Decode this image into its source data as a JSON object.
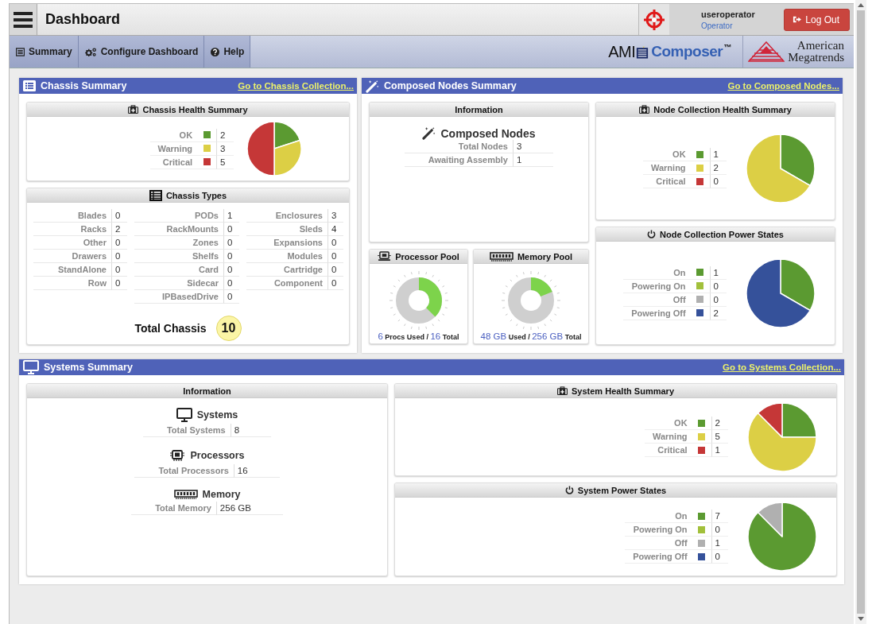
{
  "header": {
    "title": "Dashboard",
    "user": "useroperator",
    "role": "Operator",
    "logout": "Log Out"
  },
  "nav": {
    "tabs": [
      {
        "label": "Summary",
        "kind": "summary"
      },
      {
        "label": "Configure Dashboard",
        "kind": "configure"
      },
      {
        "label": "Help",
        "kind": "help"
      }
    ],
    "brand": {
      "product_prefix": "AMI",
      "product_name": "Composer",
      "trademark": "™",
      "company_line_1": "American",
      "company_line_2": "Megatrends"
    }
  },
  "chassis_summary": {
    "title": "Chassis Summary",
    "link": "Go to Chassis Collection...",
    "health": {
      "title": "Chassis Health Summary",
      "legend": [
        {
          "color": "#5b9a31",
          "value": "2"
        },
        {
          "color": "#dccf45",
          "value": "3"
        },
        {
          "color": "#c53737",
          "value": "5"
        }
      ],
      "chart_data": {
        "type": "pie",
        "categories": [
          "OK",
          "Warning",
          "Critical"
        ],
        "values": [
          20,
          30,
          50
        ]
      }
    },
    "types": {
      "title": "Chassis Types",
      "columns": [
        [
          {
            "label": "Blades",
            "value": "0"
          },
          {
            "label": "Racks",
            "value": "2"
          },
          {
            "label": "Other",
            "value": "0"
          },
          {
            "label": "Drawers",
            "value": "0"
          },
          {
            "label": "StandAlone",
            "value": "0"
          },
          {
            "label": "Row",
            "value": "0"
          }
        ],
        [
          {
            "label": "PODs",
            "value": "1"
          },
          {
            "label": "RackMounts",
            "value": "0"
          },
          {
            "label": "Zones",
            "value": "0"
          },
          {
            "label": "Shelfs",
            "value": "0"
          },
          {
            "label": "Card",
            "value": "0"
          },
          {
            "label": "Sidecar",
            "value": "0"
          },
          {
            "label": "IPBasedDrive",
            "value": "0"
          }
        ],
        [
          {
            "label": "Enclosures",
            "value": "3"
          },
          {
            "label": "Sleds",
            "value": "4"
          },
          {
            "label": "Expansions",
            "value": "0"
          },
          {
            "label": "Modules",
            "value": "0"
          },
          {
            "label": "Cartridge",
            "value": "0"
          },
          {
            "label": "Component",
            "value": "0"
          }
        ]
      ],
      "total": {
        "label": "Total Chassis",
        "value": "10"
      }
    }
  },
  "composed_nodes_summary": {
    "title": "Composed Nodes Summary",
    "link": "Go to Composed Nodes...",
    "information": {
      "title": "Information",
      "heading": "Composed Nodes",
      "rows": [
        {
          "label": "Total Nodes",
          "value": "3"
        },
        {
          "label": "Awaiting Assembly",
          "value": "1"
        }
      ]
    },
    "processor_pool": {
      "title": "Processor Pool",
      "kind": "processor",
      "used": "6",
      "used_label": "Procs Used /",
      "total": "16",
      "total_label": "Total"
    },
    "memory_pool": {
      "title": "Memory Pool",
      "kind": "memory",
      "used": "48 GB",
      "used_label": "Used /",
      "total": "256 GB",
      "total_label": "Total"
    },
    "health": {
      "title": "Node Collection Health Summary",
      "legend": [
        {
          "color": "#5b9a31",
          "value": "1"
        },
        {
          "color": "#dccf45",
          "value": "2"
        },
        {
          "color": "#c53737",
          "value": "0"
        }
      ],
      "chart_data": {
        "type": "pie",
        "categories": [
          "OK",
          "Warning",
          "Critical"
        ],
        "values": [
          33.33,
          66.67,
          0
        ]
      }
    },
    "power": {
      "title": "Node Collection Power States",
      "legend": [
        {
          "color": "#5b9a31",
          "value": "1"
        },
        {
          "color": "#a2c03b",
          "value": "0"
        },
        {
          "color": "#b0b0b0",
          "value": "0"
        },
        {
          "color": "#35519a",
          "value": "2"
        }
      ],
      "chart_data": {
        "type": "pie",
        "categories": [
          "On",
          "Powering On",
          "Off",
          "Powering Off"
        ],
        "values": [
          33.33,
          0,
          0,
          66.67
        ]
      }
    }
  },
  "systems_summary": {
    "title": "Systems Summary",
    "link": "Go to Systems Collection...",
    "information": {
      "title": "Information",
      "groups": [
        {
          "kind": "systems",
          "heading": "Systems",
          "label": "Total Systems",
          "value": "8"
        },
        {
          "kind": "processors",
          "heading": "Processors",
          "label": "Total Processors",
          "value": "16"
        },
        {
          "kind": "memory",
          "heading": "Memory",
          "label": "Total Memory",
          "value": "256 GB"
        }
      ]
    },
    "health": {
      "title": "System Health Summary",
      "legend": [
        {
          "color": "#5b9a31",
          "value": "2"
        },
        {
          "color": "#dccf45",
          "value": "5"
        },
        {
          "color": "#c53737",
          "value": "1"
        }
      ],
      "chart_data": {
        "type": "pie",
        "categories": [
          "OK",
          "Warning",
          "Critical"
        ],
        "values": [
          25,
          62.5,
          12.5
        ]
      }
    },
    "power": {
      "title": "System Power States",
      "legend": [
        {
          "color": "#5b9a31",
          "value": "7"
        },
        {
          "color": "#a2c03b",
          "value": "0"
        },
        {
          "color": "#b0b0b0",
          "value": "1"
        },
        {
          "color": "#35519a",
          "value": "0"
        }
      ],
      "chart_data": {
        "type": "pie",
        "categories": [
          "On",
          "Powering On",
          "Off",
          "Powering Off"
        ],
        "values": [
          87.5,
          0,
          12.5,
          0
        ]
      }
    }
  }
}
